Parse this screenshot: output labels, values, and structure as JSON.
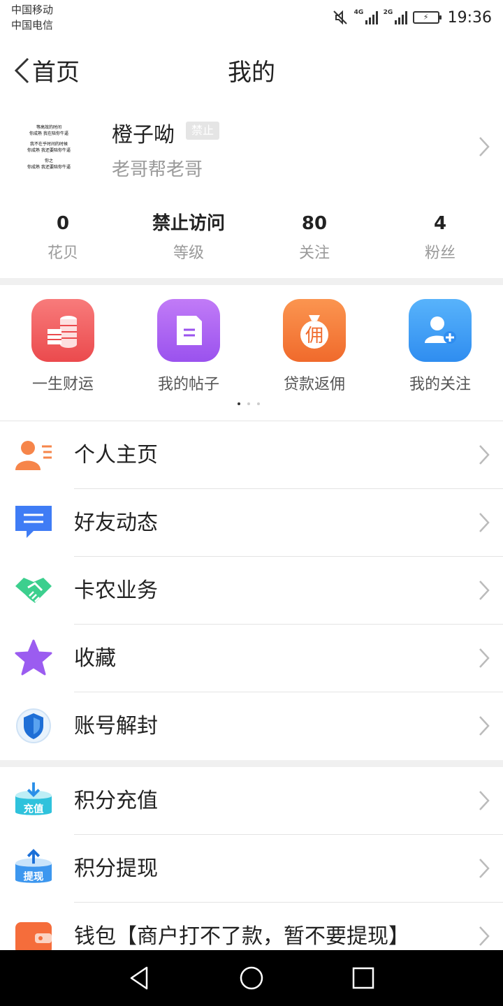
{
  "status_bar": {
    "carrier1": "中国移动",
    "carrier2": "中国电信",
    "sim1_tag": "4G",
    "sim2_tag": "2G",
    "time": "19:36"
  },
  "nav": {
    "back_label": "首页",
    "title": "我的"
  },
  "profile": {
    "avatar_lines": [
      "等高效的时间",
      "你成熟 我在陪你牛逼",
      "我不在乎时间的时候",
      "你成熟 我还要陪你牛逼",
      "你之",
      "你成熟 我还要陪你牛逼"
    ],
    "name": "橙子呦",
    "badge": "禁止",
    "subtitle": "老哥帮老哥"
  },
  "stats": [
    {
      "value": "0",
      "label": "花贝"
    },
    {
      "value": "禁止访问",
      "label": "等级"
    },
    {
      "value": "80",
      "label": "关注"
    },
    {
      "value": "4",
      "label": "粉丝"
    }
  ],
  "quick_actions": [
    {
      "label": "一生财运",
      "icon": "coins-icon",
      "color": "#f0575a"
    },
    {
      "label": "我的帖子",
      "icon": "document-icon",
      "color": "#a763f0"
    },
    {
      "label": "贷款返佣",
      "icon": "money-bag-icon",
      "color": "#f77a3a",
      "glyph": "佣"
    },
    {
      "label": "我的关注",
      "icon": "add-user-icon",
      "color": "#3d9df5"
    }
  ],
  "menu_group1": [
    {
      "label": "个人主页",
      "icon": "person-card-icon"
    },
    {
      "label": "好友动态",
      "icon": "chat-bubble-icon"
    },
    {
      "label": "卡农业务",
      "icon": "handshake-icon"
    },
    {
      "label": "收藏",
      "icon": "star-icon"
    },
    {
      "label": "账号解封",
      "icon": "shield-icon"
    }
  ],
  "menu_group2": [
    {
      "label": "积分充值",
      "icon": "recharge-icon",
      "glyph": "充值"
    },
    {
      "label": "积分提现",
      "icon": "withdraw-icon",
      "glyph": "提现"
    },
    {
      "label": "钱包【商户打不了款，暂不要提现】",
      "icon": "wallet-icon"
    }
  ]
}
